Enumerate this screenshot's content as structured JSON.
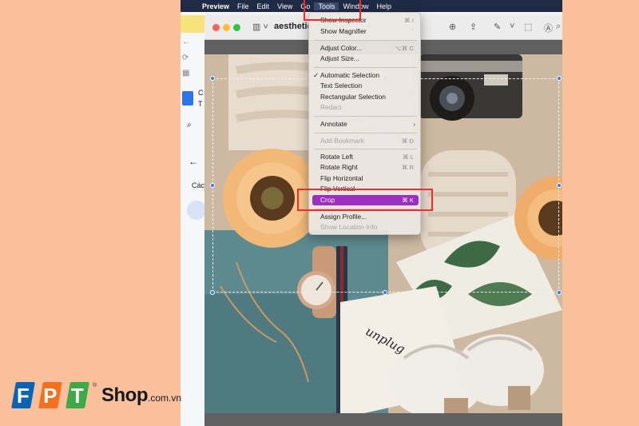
{
  "menubar": {
    "apple": "",
    "items": [
      "Preview",
      "File",
      "Edit",
      "View",
      "Go",
      "Tools",
      "Window",
      "Help"
    ]
  },
  "window": {
    "title": "aesthetic"
  },
  "tools_menu": {
    "items": [
      {
        "label": "Show Inspector",
        "shortcut": "⌘ I",
        "enabled": true
      },
      {
        "label": "Show Magnifier",
        "shortcut": "`",
        "enabled": true
      },
      {
        "label": "Adjust Color...",
        "shortcut": "⌥⌘ C",
        "enabled": true
      },
      {
        "label": "Adjust Size...",
        "shortcut": "",
        "enabled": true
      },
      {
        "label": "Automatic Selection",
        "shortcut": "",
        "enabled": true,
        "checked": true
      },
      {
        "label": "Text Selection",
        "shortcut": "",
        "enabled": true
      },
      {
        "label": "Rectangular Selection",
        "shortcut": "",
        "enabled": true
      },
      {
        "label": "Redact",
        "shortcut": "",
        "enabled": false
      },
      {
        "label": "Annotate",
        "shortcut": "",
        "enabled": true,
        "submenu": true
      },
      {
        "label": "Add Bookmark",
        "shortcut": "⌘ D",
        "enabled": false
      },
      {
        "label": "Rotate Left",
        "shortcut": "⌘ L",
        "enabled": true
      },
      {
        "label": "Rotate Right",
        "shortcut": "⌘ R",
        "enabled": true
      },
      {
        "label": "Flip Horizontal",
        "shortcut": "",
        "enabled": true
      },
      {
        "label": "Flip Vertical",
        "shortcut": "",
        "enabled": true
      },
      {
        "label": "Crop",
        "shortcut": "⌘ K",
        "enabled": true,
        "highlighted": true
      },
      {
        "label": "Assign Profile...",
        "shortcut": "",
        "enabled": true
      },
      {
        "label": "Show Location Info",
        "shortcut": "",
        "enabled": false
      }
    ],
    "submenu_arrow": "›",
    "check_mark": "✓"
  },
  "browser_fragment": {
    "letters": [
      "C",
      "T",
      "Các"
    ]
  },
  "photo": {
    "text": "unplug"
  },
  "logo": {
    "letters": [
      "F",
      "P",
      "T"
    ],
    "brand": "Shop",
    "domain": ".com.vn",
    "registered": "®",
    "colors": [
      "#0b63b6",
      "#f37021",
      "#3daa47"
    ]
  },
  "colors": {
    "background": "#f9c09b",
    "menubar": "#1f2a44",
    "highlight": "#9a2fc2",
    "annotation": "#ef2b2b",
    "selection_handle": "#2f7cf6"
  }
}
